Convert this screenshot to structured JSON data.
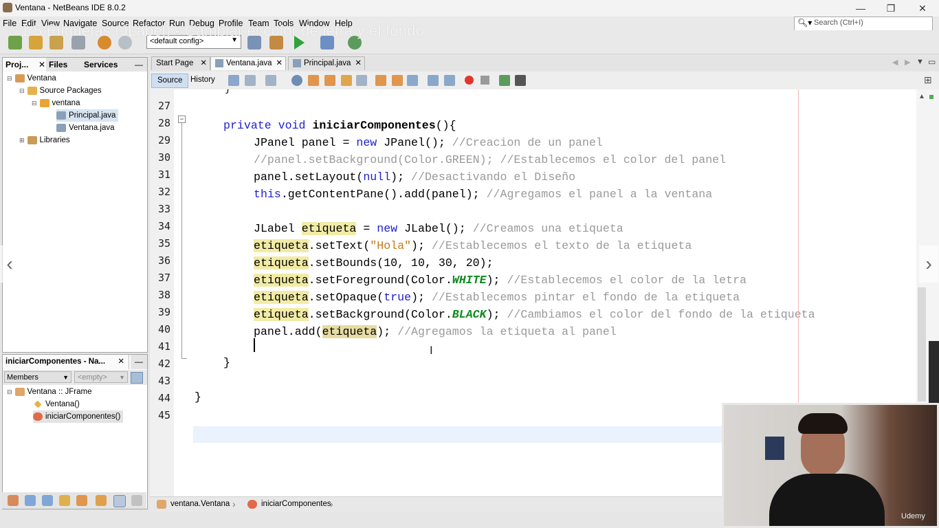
{
  "window": {
    "title": "Ventana - NetBeans IDE 8.0.2",
    "minimize": "—",
    "maximize": "❐",
    "close": "✕"
  },
  "overlay_title": "1.5 Etiquetas (JLabel) - Cambiar el color de letra y el fondo",
  "menu": [
    "File",
    "Edit",
    "View",
    "Navigate",
    "Source",
    "Refactor",
    "Run",
    "Debug",
    "Profile",
    "Team",
    "Tools",
    "Window",
    "Help"
  ],
  "search": {
    "placeholder": "Search (Ctrl+I)"
  },
  "toolbar": {
    "config": "<default config>"
  },
  "projects_panel": {
    "tabs": [
      "Proj...",
      "Files",
      "Services"
    ],
    "tree": [
      {
        "label": "Ventana",
        "icon": "project-icon"
      },
      {
        "label": "Source Packages",
        "icon": "folder-icon"
      },
      {
        "label": "ventana",
        "icon": "package-icon"
      },
      {
        "label": "Principal.java",
        "icon": "java-file-icon"
      },
      {
        "label": "Ventana.java",
        "icon": "java-file-icon"
      },
      {
        "label": "Libraries",
        "icon": "library-icon"
      }
    ]
  },
  "navigator": {
    "title": "iniciarComponentes - Na...",
    "filter": "Members",
    "empty": "<empty>",
    "tree": [
      {
        "label": "Ventana :: JFrame",
        "icon": "class-icon"
      },
      {
        "label": "Ventana()",
        "icon": "constructor-icon"
      },
      {
        "label": "iniciarComponentes()",
        "icon": "method-icon"
      }
    ]
  },
  "editor": {
    "tabs": [
      "Start Page",
      "Ventana.java",
      "Principal.java"
    ],
    "source_label": "Source",
    "history_label": "History",
    "line_numbers": [
      "27",
      "28",
      "29",
      "30",
      "31",
      "32",
      "33",
      "34",
      "35",
      "36",
      "37",
      "38",
      "39",
      "40",
      "41",
      "42",
      "43",
      "44",
      "45"
    ],
    "code": {
      "l28_mod": "private void ",
      "l28_name": "iniciarComponentes",
      "l28_end": "(){",
      "l29_a": "JPanel panel = ",
      "l29_new": "new",
      "l29_b": " JPanel(); ",
      "l29_c": "//Creacion de un panel",
      "l30": "//panel.setBackground(Color.GREEN); //Establecemos el color del panel",
      "l31_a": "panel.setLayout(",
      "l31_null": "null",
      "l31_b": "); ",
      "l31_c": "//Desactivando el Diseño",
      "l32_this": "this",
      "l32_a": ".getContentPane().add(panel); ",
      "l32_c": "//Agregamos el panel a la ventana",
      "l34_a": "JLabel ",
      "var": "etiqueta",
      "l34_b": " = ",
      "l34_new": "new",
      "l34_c": " JLabel(); ",
      "l34_cm": "//Creamos una etiqueta",
      "l35_a": ".setText(",
      "l35_str": "\"Hola\"",
      "l35_b": "); ",
      "l35_cm": "//Establecemos el texto de la etiqueta",
      "l36_a": ".setBounds(10, 10, 30, 20);",
      "l37_a": ".setForeground(Color.",
      "l37_const": "WHITE",
      "l37_b": "); ",
      "l37_cm": "//Establecemos el color de la letra",
      "l38_a": ".setOpaque(",
      "l38_true": "true",
      "l38_b": "); ",
      "l38_cm": "//Establecemos pintar el fondo de la etiqueta",
      "l39_a": ".setBackground(Color.",
      "l39_const": "BLACK",
      "l39_b": "); ",
      "l39_cm": "//Cambiamos el color del fondo de la etiqueta",
      "l40_a": "panel.add(",
      "l40_b": "); ",
      "l40_cm": "//Agregamos la etiqueta al panel",
      "l42": "}",
      "l44": "}"
    }
  },
  "breadcrumb": [
    "ventana.Ventana",
    "iniciarComponentes"
  ],
  "webcam": {
    "watermark": "Udemy"
  }
}
